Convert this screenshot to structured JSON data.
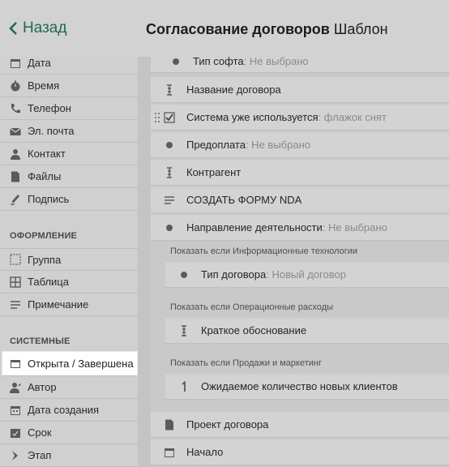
{
  "header": {
    "back_label": "Назад",
    "title_bold": "Согласование договоров",
    "title_rest": "Шаблон"
  },
  "sidebar": {
    "items_top": [
      {
        "label": "Дата",
        "icon": "calendar-icon"
      },
      {
        "label": "Время",
        "icon": "stopwatch-icon"
      },
      {
        "label": "Телефон",
        "icon": "phone-icon"
      },
      {
        "label": "Эл. почта",
        "icon": "envelope-icon"
      },
      {
        "label": "Контакт",
        "icon": "person-icon"
      },
      {
        "label": "Файлы",
        "icon": "file-icon"
      },
      {
        "label": "Подпись",
        "icon": "pen-icon"
      }
    ],
    "section_design": "ОФОРМЛЕНИЕ",
    "items_design": [
      {
        "label": "Группа",
        "icon": "group-icon"
      },
      {
        "label": "Таблица",
        "icon": "table-icon"
      },
      {
        "label": "Примечание",
        "icon": "note-icon"
      }
    ],
    "section_system": "СИСТЕМНЫЕ",
    "items_system": [
      {
        "label": "Открыта / Завершена",
        "icon": "status-icon"
      },
      {
        "label": "Автор",
        "icon": "author-icon"
      },
      {
        "label": "Дата создания",
        "icon": "calendar-created-icon"
      },
      {
        "label": "Срок",
        "icon": "deadline-icon"
      },
      {
        "label": "Этап",
        "icon": "stage-icon"
      }
    ]
  },
  "fields": {
    "r0": {
      "label": "Тип софта",
      "value": " : Не выбрано"
    },
    "r1": {
      "label": "Название договора"
    },
    "r2": {
      "label": "Система уже используется",
      "value": " : флажок снят"
    },
    "r3": {
      "label": "Предоплата",
      "value": " : Не выбрано"
    },
    "r4": {
      "label": "Контрагент"
    },
    "r5": {
      "label": "СОЗДАТЬ ФОРМУ NDA"
    },
    "r6": {
      "label": "Направление деятельности",
      "value": " : Не выбрано"
    },
    "c1": {
      "condition": "Показать если Информационные технологии",
      "label": "Тип договора",
      "value": " : Новый договор"
    },
    "c2": {
      "condition": "Показать если Операционные расходы",
      "label": "Краткое обоснование"
    },
    "c3": {
      "condition": "Показать если Продажи и маркетинг",
      "label": "Ожидаемое количество новых клиентов"
    },
    "r7": {
      "label": "Проект договора"
    },
    "r8": {
      "label": "Начало"
    }
  },
  "colors": {
    "accent": "#1f6b4e",
    "active_bg": "#ffffff",
    "overlay_bg": "#c9c9c9"
  }
}
